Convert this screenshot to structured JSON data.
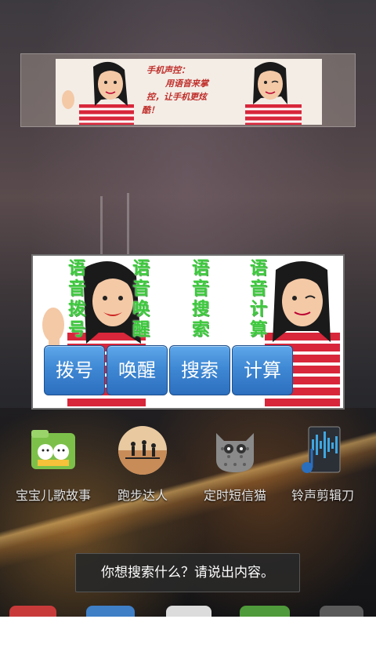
{
  "banner": {
    "lines": [
      "手机声控：",
      "用语音来掌",
      "控，让手机更炫",
      "酷！"
    ]
  },
  "widget": {
    "columns": [
      [
        "语",
        "音",
        "拨",
        "号"
      ],
      [
        "语",
        "音",
        "唤",
        "醒"
      ],
      [
        "语",
        "音",
        "搜",
        "索"
      ],
      [
        "语",
        "音",
        "计",
        "算"
      ]
    ],
    "buttons": [
      "拨号",
      "唤醒",
      "搜索",
      "计算"
    ]
  },
  "apps": [
    {
      "label": "宝宝儿歌故事",
      "icon": "kids-songs-icon"
    },
    {
      "label": "跑步达人",
      "icon": "running-icon"
    },
    {
      "label": "定时短信猫",
      "icon": "sms-cat-icon"
    },
    {
      "label": "铃声剪辑刀",
      "icon": "ringtone-cutter-icon"
    }
  ],
  "toast": {
    "text": "你想搜索什么？请说出内容。"
  }
}
